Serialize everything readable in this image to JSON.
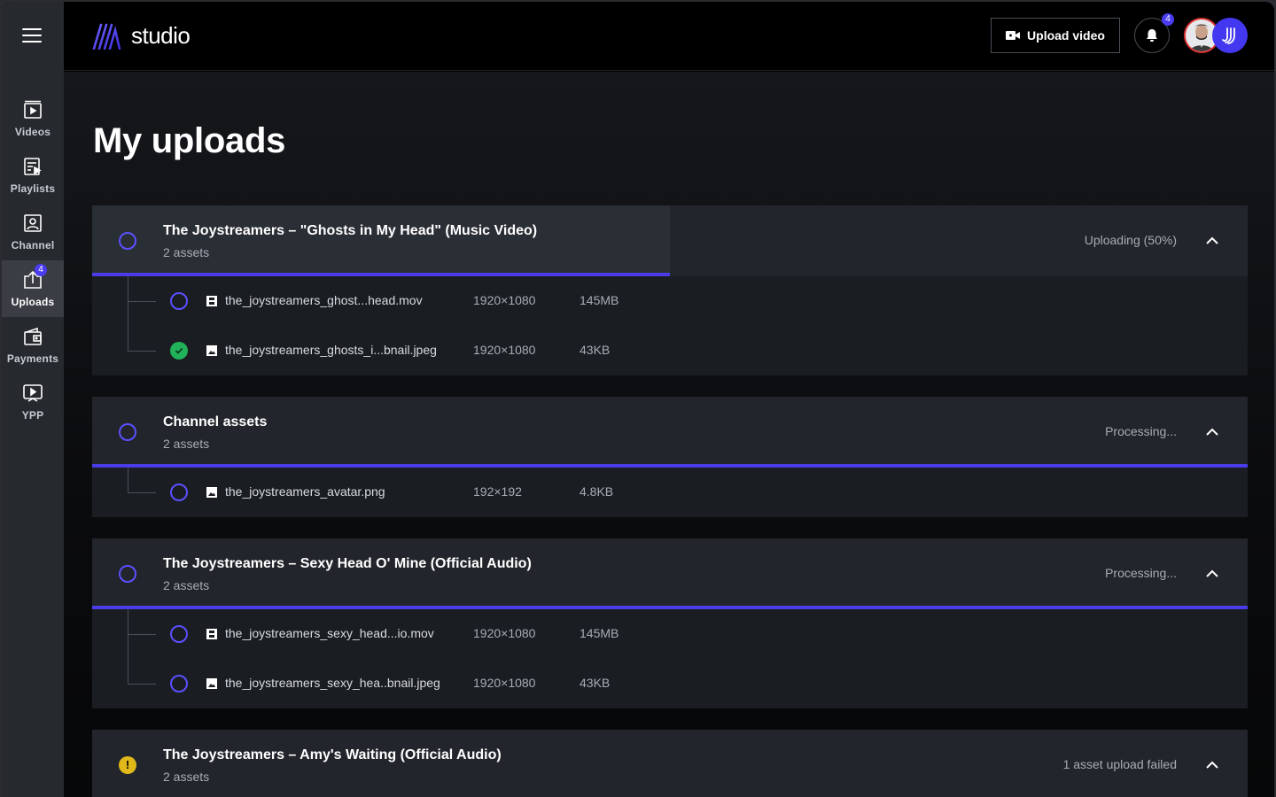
{
  "app": {
    "logo_text": "studio",
    "upload_button_label": "Upload video",
    "notification_count": "4"
  },
  "sidebar": {
    "items": [
      {
        "label": "Videos",
        "icon": "videos-icon"
      },
      {
        "label": "Playlists",
        "icon": "playlists-icon"
      },
      {
        "label": "Channel",
        "icon": "channel-icon"
      },
      {
        "label": "Uploads",
        "icon": "uploads-icon",
        "badge": "4",
        "active": true
      },
      {
        "label": "Payments",
        "icon": "payments-icon"
      },
      {
        "label": "YPP",
        "icon": "ypp-icon"
      }
    ]
  },
  "page": {
    "title": "My uploads"
  },
  "uploads": [
    {
      "title": "The Joystreamers – \"Ghosts in My Head\" (Music Video)",
      "subtitle": "2 assets",
      "status": "Uploading (50%)",
      "progress": 0.5,
      "assets": [
        {
          "name": "the_joystreamers_ghost...head.mov",
          "resolution": "1920×1080",
          "size": "145MB",
          "type": "video",
          "state": "pending"
        },
        {
          "name": "the_joystreamers_ghosts_i...bnail.jpeg",
          "resolution": "1920×1080",
          "size": "43KB",
          "type": "image",
          "state": "done"
        }
      ]
    },
    {
      "title": "Channel assets",
      "subtitle": "2 assets",
      "status": "Processing...",
      "progress": 1.0,
      "assets": [
        {
          "name": "the_joystreamers_avatar.png",
          "resolution": "192×192",
          "size": "4.8KB",
          "type": "image",
          "state": "pending"
        }
      ]
    },
    {
      "title": "The Joystreamers – Sexy Head O' Mine (Official Audio)",
      "subtitle": "2 assets",
      "status": "Processing...",
      "progress": 1.0,
      "assets": [
        {
          "name": "the_joystreamers_sexy_head...io.mov",
          "resolution": "1920×1080",
          "size": "145MB",
          "type": "video",
          "state": "pending"
        },
        {
          "name": "the_joystreamers_sexy_hea..bnail.jpeg",
          "resolution": "1920×1080",
          "size": "43KB",
          "type": "image",
          "state": "pending"
        }
      ]
    },
    {
      "title": "The Joystreamers – Amy's Waiting (Official Audio)",
      "subtitle": "2 assets",
      "status": "1 asset upload failed",
      "progress": 0,
      "warning": "!"
    }
  ],
  "colors": {
    "accent": "#4a3ce6",
    "success": "#21b25a",
    "warning": "#e0b81a"
  }
}
